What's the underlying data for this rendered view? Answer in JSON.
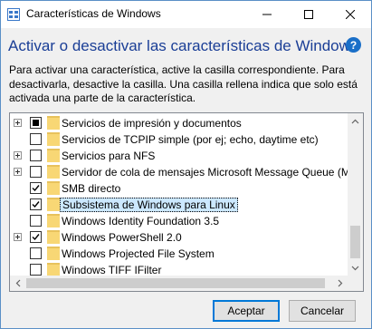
{
  "window": {
    "title": "Características de Windows"
  },
  "header": {
    "title": "Activar o desactivar las características de Windows",
    "help_glyph": "?"
  },
  "description": "Para activar una característica, active la casilla correspondiente. Para desactivarla, desactive la casilla. Una casilla rellena indica que solo está activada una parte de la característica.",
  "features": [
    {
      "label": "Servicios de impresión y documentos",
      "state": "partial",
      "expandable": true,
      "selected": false
    },
    {
      "label": "Servicios de TCPIP simple (por ej; echo, daytime etc)",
      "state": "unchecked",
      "expandable": false,
      "selected": false
    },
    {
      "label": "Servicios para NFS",
      "state": "unchecked",
      "expandable": true,
      "selected": false
    },
    {
      "label": "Servidor de cola de mensajes Microsoft Message Queue (MS",
      "state": "unchecked",
      "expandable": true,
      "selected": false
    },
    {
      "label": "SMB directo",
      "state": "checked",
      "expandable": false,
      "selected": false
    },
    {
      "label": "Subsistema de Windows para Linux",
      "state": "checked",
      "expandable": false,
      "selected": true
    },
    {
      "label": "Windows Identity Foundation 3.5",
      "state": "unchecked",
      "expandable": false,
      "selected": false
    },
    {
      "label": "Windows PowerShell 2.0",
      "state": "checked",
      "expandable": true,
      "selected": false
    },
    {
      "label": "Windows Projected File System",
      "state": "unchecked",
      "expandable": false,
      "selected": false
    },
    {
      "label": "Windows TIFF IFilter",
      "state": "unchecked",
      "expandable": false,
      "selected": false
    }
  ],
  "buttons": {
    "ok": "Aceptar",
    "cancel": "Cancelar"
  },
  "colors": {
    "header_title": "#1a3e96",
    "selection": "#cce8ff",
    "folder": "#f8d775",
    "accent": "#0078d7"
  }
}
